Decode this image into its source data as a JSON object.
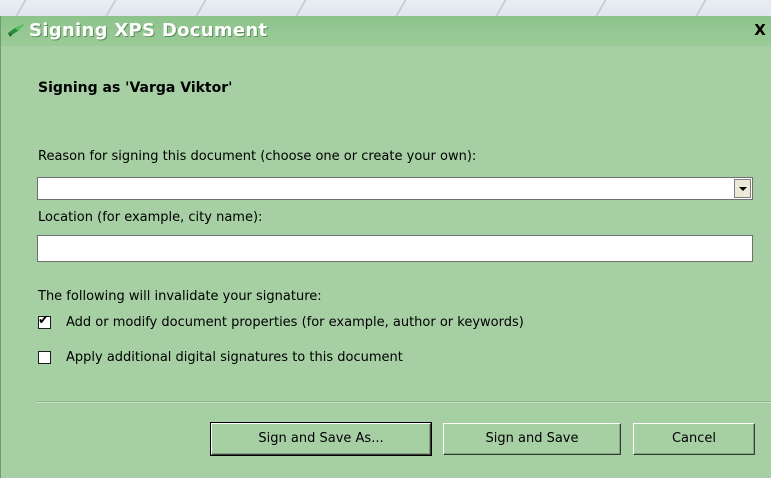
{
  "window": {
    "title": "Signing XPS Document",
    "close_glyph": "X",
    "icon": "signature-pen-icon"
  },
  "content": {
    "heading": "Signing as 'Varga Viktor'",
    "reason_label": "Reason for signing this document (choose one or create your own):",
    "reason_value": "",
    "location_label": "Location (for example, city name):",
    "location_value": "",
    "invalidate_label": "The following will invalidate your signature:",
    "options": [
      {
        "label": "Add or modify document properties (for example, author or keywords)",
        "checked": true
      },
      {
        "label": "Apply additional digital signatures to this document",
        "checked": false
      }
    ]
  },
  "buttons": {
    "sign_save_as": "Sign and Save As...",
    "sign_save": "Sign and Save",
    "cancel": "Cancel"
  },
  "colors": {
    "dialog_bg": "#a6cfa4",
    "title_text": "#ffffff"
  }
}
